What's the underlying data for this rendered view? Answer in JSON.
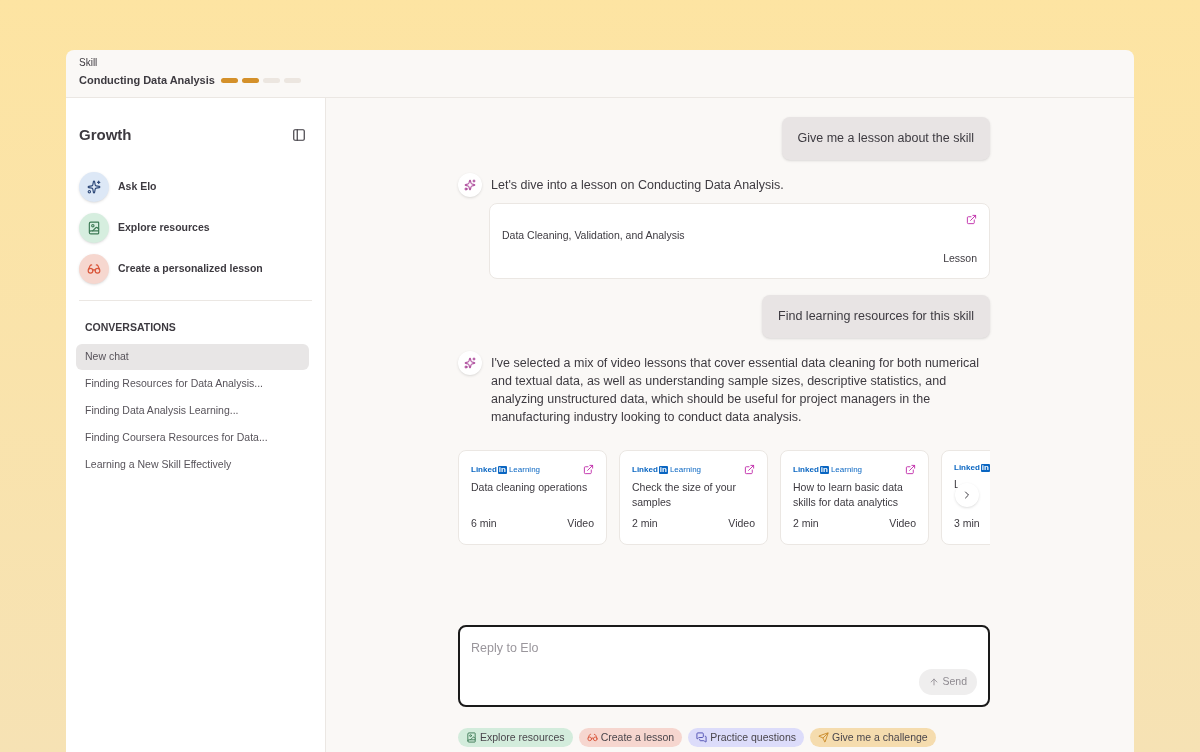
{
  "header": {
    "label": "Skill",
    "title": "Conducting Data Analysis",
    "progress": [
      {
        "filled": true
      },
      {
        "filled": true
      },
      {
        "filled": false
      },
      {
        "filled": false
      }
    ]
  },
  "sidebar": {
    "title": "Growth",
    "actions": [
      {
        "kind": "ask",
        "label": "Ask Elo"
      },
      {
        "kind": "explore",
        "label": "Explore resources"
      },
      {
        "kind": "lesson",
        "label": "Create a personalized lesson"
      }
    ],
    "conversations_heading": "CONVERSATIONS",
    "conversations": [
      {
        "label": "New chat",
        "selected": true
      },
      {
        "label": "Finding Resources for Data Analysis...",
        "selected": false
      },
      {
        "label": "Finding Data Analysis Learning...",
        "selected": false
      },
      {
        "label": "Finding Coursera Resources for Data...",
        "selected": false
      },
      {
        "label": "Learning a New Skill Effectively",
        "selected": false
      }
    ]
  },
  "messages": [
    {
      "kind": "user",
      "text": "Give me a lesson about the skill"
    },
    {
      "kind": "bot",
      "text": "Let's dive into a lesson on Conducting Data Analysis.",
      "lesson": {
        "title": "Data Cleaning, Validation, and Analysis",
        "type": "Lesson"
      }
    },
    {
      "kind": "user",
      "text": "Find learning resources for this skill"
    },
    {
      "kind": "bot",
      "text": "I've selected a mix of video lessons that cover essential data cleaning for both numerical and textual data, as well as understanding sample sizes, descriptive statistics, and analyzing unstructured data, which should be useful for project managers in the manufacturing industry looking to conduct data analysis.",
      "resources": [
        {
          "provider": [
            "Linked",
            "in",
            "Learning"
          ],
          "title": "Data cleaning operations",
          "duration": "6 min",
          "type": "Video"
        },
        {
          "provider": [
            "Linked",
            "in",
            "Learning"
          ],
          "title": "Check the size of your samples",
          "duration": "2 min",
          "type": "Video"
        },
        {
          "provider": [
            "Linked",
            "in",
            "Learning"
          ],
          "title": "How to learn basic data skills for data analytics",
          "duration": "2 min",
          "type": "Video"
        },
        {
          "provider": [
            "Linked",
            "in"
          ],
          "title": "L",
          "duration": "3 min"
        }
      ]
    }
  ],
  "composer": {
    "placeholder": "Reply to Elo",
    "send": "Send",
    "send_disabled": true
  },
  "suggestions": [
    {
      "kind": "explore",
      "label": "Explore resources",
      "color": "#d3ecdc"
    },
    {
      "kind": "lesson",
      "label": "Create a lesson",
      "color": "#f6d6cf"
    },
    {
      "kind": "practice",
      "label": "Practice questions",
      "color": "#dcdcfa"
    },
    {
      "kind": "challenge",
      "label": "Give me a challenge",
      "color": "#f5dcae"
    }
  ]
}
